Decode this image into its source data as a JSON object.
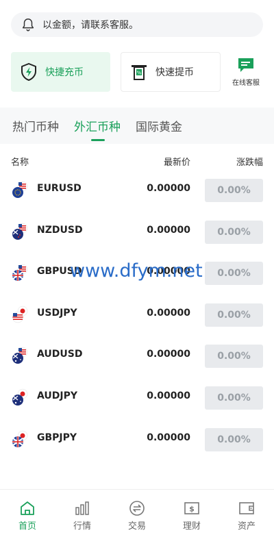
{
  "notice": {
    "text": "以金额，请联系客服。"
  },
  "quick_actions": {
    "recharge_label": "快捷充币",
    "withdraw_label": "快速提币",
    "service_label": "在线客服"
  },
  "tabs": [
    {
      "label": "热门币种",
      "active": false
    },
    {
      "label": "外汇币种",
      "active": true
    },
    {
      "label": "国际黄金",
      "active": false
    }
  ],
  "table": {
    "headers": {
      "name": "名称",
      "price": "最新价",
      "change": "涨跌幅"
    },
    "rows": [
      {
        "symbol": "EURUSD",
        "price": "0.00000",
        "change": "0.00%"
      },
      {
        "symbol": "NZDUSD",
        "price": "0.00000",
        "change": "0.00%"
      },
      {
        "symbol": "GBPUSD",
        "price": "0.00000",
        "change": "0.00%"
      },
      {
        "symbol": "USDJPY",
        "price": "0.00000",
        "change": "0.00%"
      },
      {
        "symbol": "AUDUSD",
        "price": "0.00000",
        "change": "0.00%"
      },
      {
        "symbol": "AUDJPY",
        "price": "0.00000",
        "change": "0.00%"
      },
      {
        "symbol": "GBPJPY",
        "price": "0.00000",
        "change": "0.00%"
      }
    ]
  },
  "watermark": "www.dfym.net",
  "bottom_nav": [
    {
      "label": "首页",
      "icon": "home-icon",
      "active": true
    },
    {
      "label": "行情",
      "icon": "bar-chart-icon",
      "active": false
    },
    {
      "label": "交易",
      "icon": "exchange-icon",
      "active": false
    },
    {
      "label": "理财",
      "icon": "finance-icon",
      "active": false
    },
    {
      "label": "资产",
      "icon": "wallet-icon",
      "active": false
    }
  ],
  "colors": {
    "accent": "#1aa05a",
    "change_bg": "#e8eaed",
    "change_text": "#9aa0a6",
    "watermark": "#2a6cc8"
  }
}
